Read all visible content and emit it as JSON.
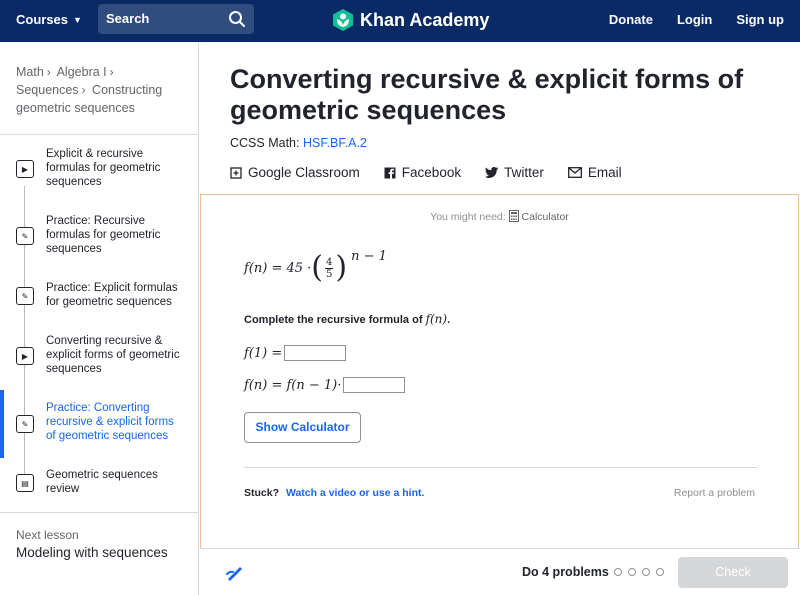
{
  "topnav": {
    "courses_label": "Courses",
    "search_label": "Search",
    "brand": "Khan Academy",
    "links": [
      "Donate",
      "Login",
      "Sign up"
    ]
  },
  "sidebar": {
    "breadcrumb": [
      "Math",
      "Algebra I",
      "Sequences",
      "Constructing geometric sequences"
    ],
    "items": [
      {
        "label": "Explicit & recursive formulas for geometric sequences",
        "icon": "play-icon"
      },
      {
        "label": "Practice: Recursive formulas for geometric sequences",
        "icon": "pencil-icon"
      },
      {
        "label": "Practice: Explicit formulas for geometric sequences",
        "icon": "pencil-icon"
      },
      {
        "label": "Converting recursive & explicit forms of geometric sequences",
        "icon": "play-icon"
      },
      {
        "label": "Practice: Converting recursive & explicit forms of geometric sequences",
        "icon": "pencil-icon"
      },
      {
        "label": "Geometric sequences review",
        "icon": "document-icon"
      }
    ],
    "next_lesson_label": "Next lesson",
    "next_lesson": "Modeling with sequences"
  },
  "main": {
    "title": "Converting recursive & explicit forms of geometric sequences",
    "ccss_label": "CCSS Math:",
    "ccss_code": "HSF.BF.A.2",
    "share": [
      "Google Classroom",
      "Facebook",
      "Twitter",
      "Email"
    ]
  },
  "exercise": {
    "might_need_label": "You might need:",
    "might_need_tool": "Calculator",
    "formula": {
      "lhs": "f(n) = 45 ·",
      "frac_num": "4",
      "frac_den": "5",
      "exponent": "n − 1"
    },
    "prompt_prefix": "Complete the recursive formula of",
    "prompt_math": "f(n)",
    "prompt_suffix": ".",
    "row1_lhs": "f(1) =",
    "row2_lhs": "f(n) = f(n − 1)·",
    "show_calculator": "Show Calculator",
    "stuck_label": "Stuck?",
    "stuck_link": "Watch a video or use a hint.",
    "report": "Report a problem"
  },
  "footer": {
    "do_problems": "Do 4 problems",
    "progress_completed": 0,
    "progress_total": 4,
    "check": "Check"
  },
  "colors": {
    "nav_bg": "#0a2a66",
    "link_blue": "#1865f2",
    "panel_border": "#f2c08c",
    "brand_green": "#14bf96"
  }
}
